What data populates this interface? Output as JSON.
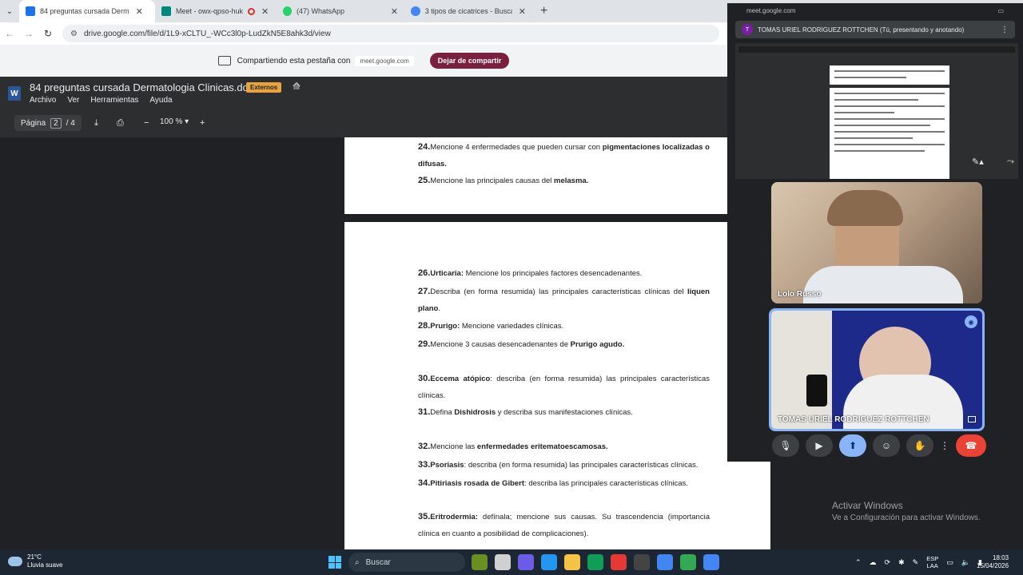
{
  "browser": {
    "tabs": [
      {
        "title": "84 preguntas cursada Derm",
        "favicon_color": "#1a73e8",
        "active": true
      },
      {
        "title": "Meet - owx-qpso-huk",
        "favicon_color": "#00897b",
        "active": false
      },
      {
        "title": "(47) WhatsApp",
        "favicon_color": "#25d366",
        "active": false
      },
      {
        "title": "3 tipos de cicatrices - Buscar co",
        "favicon_color": "#4285f4",
        "active": false
      }
    ],
    "url": "drive.google.com/file/d/1L9-xCLTU_-WCc3l0p-LudZkN5E8ahk3d/view",
    "share_bar": {
      "text": "Compartiendo esta pestaña con",
      "site": "meet.google.com",
      "stop_label": "Dejar de compartir"
    }
  },
  "viewer": {
    "title": "84 preguntas cursada Dermatologia Clinicas.doc",
    "badge": "Externos",
    "menu": [
      "Archivo",
      "Ver",
      "Herramientas",
      "Ayuda"
    ],
    "page_label": "Página",
    "page_current": "2",
    "page_total": "/ 4",
    "zoom": "100 %"
  },
  "document": {
    "page1": [
      {
        "num": "24.",
        "html": "Mencione 4 enfermedades que pueden cursar con <b>pigmentaciones localizadas o difusas.</b>"
      },
      {
        "num": "25.",
        "html": "Mencione las principales causas del <b>melasma.</b>"
      }
    ],
    "page2": [
      {
        "num": "26.",
        "html": "<b>Urticaria:</b> Mencione los principales factores desencadenantes."
      },
      {
        "num": "27.",
        "html": "Describa (en forma resumida) las principales características clínicas del <b>liquen plano</b>."
      },
      {
        "num": "28.",
        "html": "<b>Prurigo:</b> Mencione variedades clínicas."
      },
      {
        "num": "29.",
        "html": "Mencione 3 causas desencadenantes de <b>Prurigo agudo.</b>"
      },
      {
        "num": "30.",
        "html": "<b>Eccema atópico</b>: describa (en forma resumida) las principales características clínicas."
      },
      {
        "num": "31.",
        "html": "Defina <b>Dishidrosis</b> y describa sus manifestaciones clínicas."
      },
      {
        "num": "32.",
        "html": "Mencione las <b>enfermedades eritematoescamosas.</b>"
      },
      {
        "num": "33.",
        "html": "<b>Psoriasis</b>: describa (en forma resumida) las principales características clínicas."
      },
      {
        "num": "34.",
        "html": "<b>Pitiriasis rosada de Gibert</b>: describa las principales características clínicas."
      },
      {
        "num": "35.",
        "html": "<b>Eritrodermia:</b> defínala; mencione sus causas. Su trascendencia (importancia clínica en cuanto a posibilidad de complicaciones)."
      }
    ]
  },
  "meet": {
    "host": "meet.google.com",
    "presenter_initial": "T",
    "presenter_text": "TOMAS URIEL RODRIGUEZ ROTTCHEN (Tú, presentando y anotando)",
    "participants": [
      {
        "name": "Lolo Russo"
      },
      {
        "name": "TOMAS URIEL RODRIGUEZ ROTTCHEN"
      }
    ]
  },
  "desktop": {
    "activate_title": "Activar Windows",
    "activate_sub": "Ve a Configuración para activar Windows."
  },
  "taskbar": {
    "temp": "21°C",
    "weather": "Lluvia suave",
    "search_placeholder": "Buscar",
    "lang1": "ESP",
    "lang2": "LAA",
    "time": "18:03",
    "date": "15/04/2026",
    "app_colors": [
      "#6b8e23",
      "#d0d0d0",
      "#6c5ce7",
      "#2196f3",
      "#f6c344",
      "#0f9d58",
      "#e53935",
      "#444444",
      "#4285f4",
      "#34a853",
      "#4285f4"
    ]
  }
}
